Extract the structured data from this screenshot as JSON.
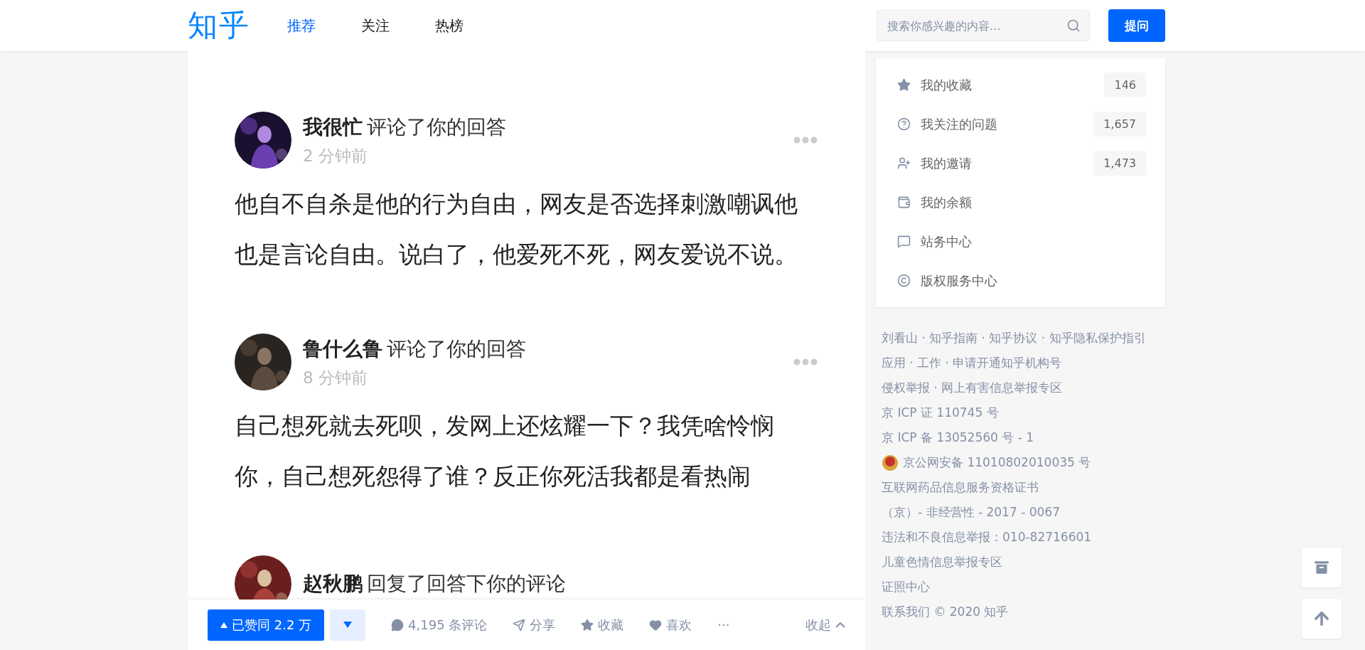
{
  "header": {
    "logo": "知乎",
    "tabs": [
      {
        "label": "推荐",
        "selected": true
      },
      {
        "label": "关注",
        "selected": false
      },
      {
        "label": "热榜",
        "selected": false
      }
    ],
    "search": {
      "placeholder": "搜索你感兴趣的内容..."
    },
    "ask_button": "提问"
  },
  "comments": [
    {
      "author": "我很忙",
      "action": "评论了你的回答",
      "time": "2 分钟前",
      "text": "他自不自杀是他的行为自由，网友是否选择刺激嘲讽他也是言论自由。说白了，他爱死不死，网友爱说不说。"
    },
    {
      "author": "鲁什么鲁",
      "action": "评论了你的回答",
      "time": "8 分钟前",
      "text": "自己想死就去死呗，发网上还炫耀一下？我凭啥怜悯你，自己想死怨得了谁？反正你死活我都是看热闹"
    },
    {
      "author": "赵秋鹏",
      "action": "回复了回答下你的评论"
    }
  ],
  "actions": {
    "upvote": "已赞同 2.2 万",
    "upvoted": true,
    "comments": "4,195 条评论",
    "share": "分享",
    "favorite": "收藏",
    "like": "喜欢",
    "more": "···",
    "collapse": "收起"
  },
  "sidebar": {
    "items": [
      {
        "kind": "star",
        "label": "我的收藏",
        "count": "146"
      },
      {
        "kind": "question",
        "label": "我关注的问题",
        "count": "1,657"
      },
      {
        "kind": "invite",
        "label": "我的邀请",
        "count": "1,473"
      },
      {
        "kind": "wallet",
        "label": "我的余额"
      },
      {
        "kind": "notice",
        "label": "站务中心"
      },
      {
        "kind": "copyright",
        "label": "版权服务中心"
      }
    ]
  },
  "footer": {
    "lines": [
      {
        "text": "刘看山 · 知乎指南 · 知乎协议 · 知乎隐私保护指引"
      },
      {
        "text": "应用 · 工作 · 申请开通知乎机构号"
      },
      {
        "text": "侵权举报 · 网上有害信息举报专区"
      },
      {
        "text": "京 ICP 证 110745 号"
      },
      {
        "text": "京 ICP 备 13052560 号 - 1"
      },
      {
        "text": "京公网安备 11010802010035 号",
        "kind": "badge"
      },
      {
        "text": "互联网药品信息服务资格证书"
      },
      {
        "text": "（京）- 非经营性 - 2017 - 0067"
      },
      {
        "text": "违法和不良信息举报：010-82716601"
      },
      {
        "text": "儿童色情信息举报专区"
      },
      {
        "text": "证照中心"
      },
      {
        "text": "联系我们 © 2020 知乎"
      }
    ]
  }
}
